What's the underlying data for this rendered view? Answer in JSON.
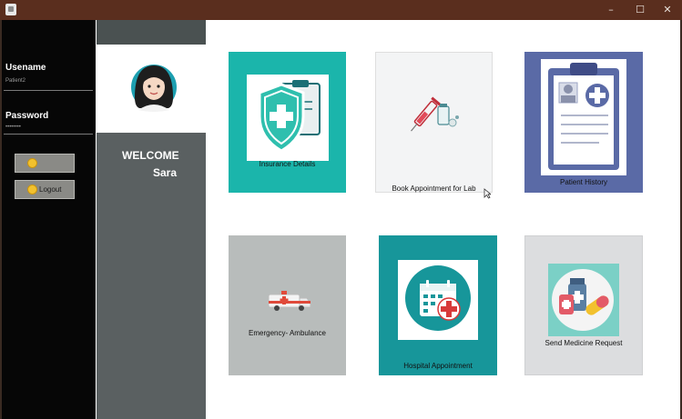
{
  "window": {
    "minimize": "–",
    "maximize": "☐",
    "close": "✕"
  },
  "sidebar": {
    "username_label": "Usename",
    "username_value": "Patient2",
    "password_label": "Password",
    "password_value": "••••••••",
    "logout_label": "Logout"
  },
  "profile": {
    "welcome": "WELCOME",
    "name": "Sara"
  },
  "tiles": {
    "insurance": "Insurance Details",
    "lab": "Book Appointment for Lab",
    "history": "Patient History",
    "emergency": "Emergency- Ambulance",
    "hospital": "Hospital Appointment",
    "medicine": "Send Medicine Request"
  },
  "colors": {
    "insurance": "#1bb5ab",
    "history": "#5a6aa6",
    "hospital": "#17969a"
  }
}
